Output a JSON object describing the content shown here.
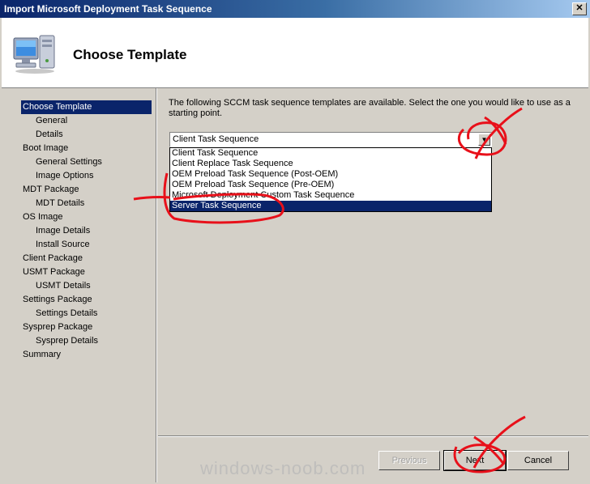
{
  "window": {
    "title": "Import Microsoft Deployment Task Sequence",
    "close_label": "✕"
  },
  "header": {
    "heading": "Choose Template",
    "icon": "computer-icon"
  },
  "sidebar": {
    "items": [
      {
        "label": "Choose Template",
        "level": 0,
        "active": true
      },
      {
        "label": "General",
        "level": 1
      },
      {
        "label": "Details",
        "level": 1
      },
      {
        "label": "Boot Image",
        "level": 0
      },
      {
        "label": "General Settings",
        "level": 1
      },
      {
        "label": "Image Options",
        "level": 1
      },
      {
        "label": "MDT Package",
        "level": 0
      },
      {
        "label": "MDT Details",
        "level": 1
      },
      {
        "label": "OS Image",
        "level": 0
      },
      {
        "label": "Image Details",
        "level": 1
      },
      {
        "label": "Install Source",
        "level": 1
      },
      {
        "label": "Client Package",
        "level": 0
      },
      {
        "label": "USMT Package",
        "level": 0
      },
      {
        "label": "USMT Details",
        "level": 1
      },
      {
        "label": "Settings Package",
        "level": 0
      },
      {
        "label": "Settings Details",
        "level": 1
      },
      {
        "label": "Sysprep Package",
        "level": 0
      },
      {
        "label": "Sysprep Details",
        "level": 1
      },
      {
        "label": "Summary",
        "level": 0
      }
    ]
  },
  "main": {
    "intro": "The following SCCM task sequence templates are available.  Select the one you would like to use as a starting point.",
    "template_select": {
      "value": "Client Task Sequence",
      "options": [
        "Client Task Sequence",
        "Client Replace Task Sequence",
        "OEM Preload Task Sequence (Post-OEM)",
        "OEM Preload Task Sequence (Pre-OEM)",
        "Microsoft Deployment Custom Task Sequence",
        "Server Task Sequence"
      ],
      "highlighted": "Server Task Sequence"
    }
  },
  "footer": {
    "previous_label": "Previous",
    "next_label": "Next",
    "cancel_label": "Cancel"
  },
  "watermark": "windows-noob.com",
  "colors": {
    "selection": "#0a246a",
    "annotation": "#e8101a",
    "dialog": "#d4d0c8"
  }
}
